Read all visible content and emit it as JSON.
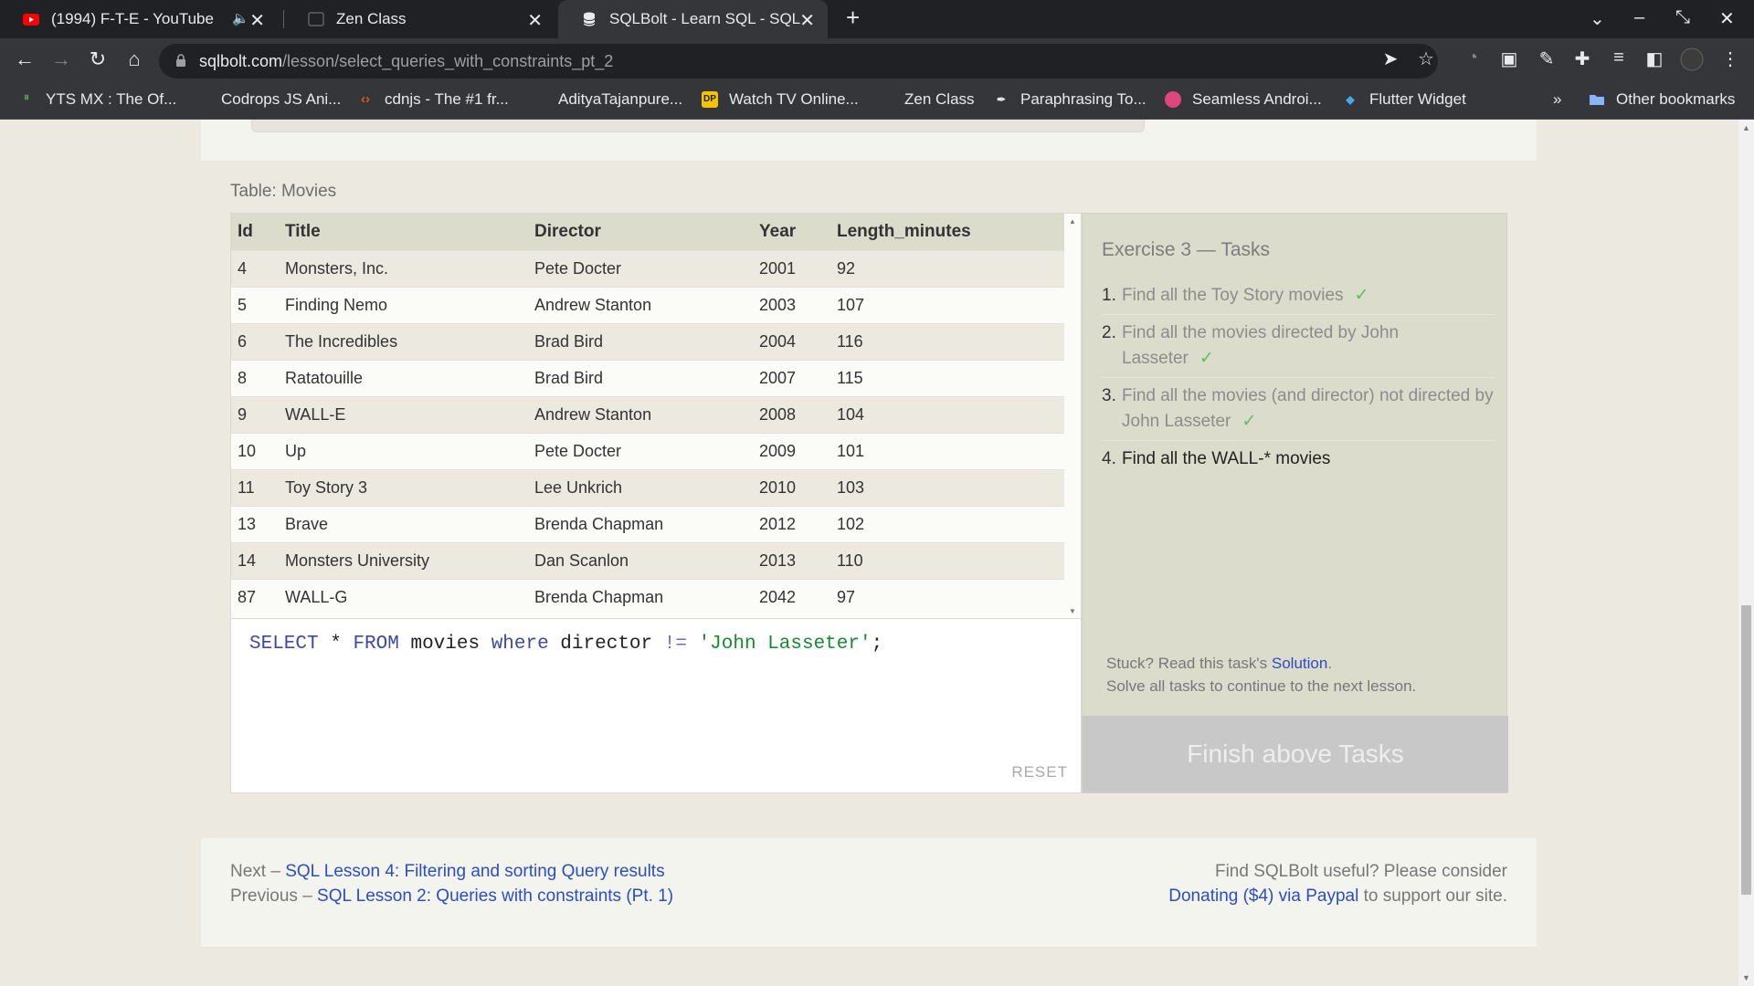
{
  "browser": {
    "tabs": [
      {
        "title": "(1994) F-T-E - YouTube",
        "icon": "youtube-icon",
        "muted_icon": "speaker-icon"
      },
      {
        "title": "Zen Class",
        "icon": "zen-class-icon"
      },
      {
        "title": "SQLBolt - Learn SQL - SQL L",
        "icon": "database-icon",
        "active": true
      }
    ],
    "new_tab": "+",
    "window_controls": {
      "dropdown": "⌄",
      "minimize": "–",
      "restore": "⤡",
      "close": "✕"
    },
    "url": {
      "host": "sqlbolt.com",
      "path": "/lesson/select_queries_with_constraints_pt_2"
    },
    "bookmarks": [
      {
        "label": "YTS MX : The Of...",
        "icon": "yts-icon",
        "color": "#6ac045"
      },
      {
        "label": "Codrops JS Ani...",
        "icon": "codrops-icon",
        "color": "#202124"
      },
      {
        "label": "cdnjs - The #1 fr...",
        "icon": "cdnjs-icon",
        "color": "#e95420"
      },
      {
        "label": "AdityaTajanpure...",
        "icon": "github-icon",
        "color": "#202124"
      },
      {
        "label": "Watch TV Online...",
        "icon": "dp-icon",
        "color": "#f6c300"
      },
      {
        "label": "Zen Class",
        "icon": "zen-class-icon",
        "color": "#202124"
      },
      {
        "label": "Paraphrasing To...",
        "icon": "quill-icon",
        "color": "#e8eaed"
      },
      {
        "label": "Seamless Androi...",
        "icon": "avatar-icon",
        "color": "#e0457b"
      },
      {
        "label": "Flutter Widget",
        "icon": "flutter-icon",
        "color": "#45a8ef"
      }
    ],
    "bookmarks_overflow": "»",
    "other_bookmarks": "Other bookmarks"
  },
  "lesson": {
    "table_caption": "Table: Movies",
    "columns": [
      "Id",
      "Title",
      "Director",
      "Year",
      "Length_minutes"
    ],
    "rows": [
      [
        "4",
        "Monsters, Inc.",
        "Pete Docter",
        "2001",
        "92"
      ],
      [
        "5",
        "Finding Nemo",
        "Andrew Stanton",
        "2003",
        "107"
      ],
      [
        "6",
        "The Incredibles",
        "Brad Bird",
        "2004",
        "116"
      ],
      [
        "8",
        "Ratatouille",
        "Brad Bird",
        "2007",
        "115"
      ],
      [
        "9",
        "WALL-E",
        "Andrew Stanton",
        "2008",
        "104"
      ],
      [
        "10",
        "Up",
        "Pete Docter",
        "2009",
        "101"
      ],
      [
        "11",
        "Toy Story 3",
        "Lee Unkrich",
        "2010",
        "103"
      ],
      [
        "13",
        "Brave",
        "Brenda Chapman",
        "2012",
        "102"
      ],
      [
        "14",
        "Monsters University",
        "Dan Scanlon",
        "2013",
        "110"
      ],
      [
        "87",
        "WALL-G",
        "Brenda Chapman",
        "2042",
        "97"
      ]
    ],
    "query": {
      "select": "SELECT",
      "star": " * ",
      "from": "FROM",
      "table": " movies ",
      "where": "where",
      "column": " director ",
      "op": "!=",
      "space": " ",
      "value": "'John Lasseter'",
      "end": ";"
    },
    "reset_label": "RESET",
    "tasks": {
      "title": "Exercise 3 — Tasks",
      "items": [
        {
          "num": "1.",
          "text": "Find all the Toy Story movies",
          "done": "✓"
        },
        {
          "num": "2.",
          "text": "Find all the movies directed by John Lasseter",
          "done": "✓"
        },
        {
          "num": "3.",
          "text": "Find all the movies (and director) not directed by John Lasseter",
          "done": "✓"
        },
        {
          "num": "4.",
          "text": "Find all the WALL-* movies",
          "done": ""
        }
      ],
      "stuck_prefix": "Stuck? Read this task's ",
      "solution_link": "Solution",
      "stuck_suffix": ".",
      "continue_note": "Solve all tasks to continue to the next lesson.",
      "finish_label": "Finish above Tasks"
    },
    "footer": {
      "next_prefix": "Next – ",
      "next_link": "SQL Lesson 4: Filtering and sorting Query results",
      "prev_prefix": "Previous – ",
      "prev_link": "SQL Lesson 2: Queries with constraints (Pt. 1)",
      "support_text": "Find SQLBolt useful? Please consider",
      "donate_link": "Donating ($4) via Paypal",
      "support_suffix": " to support our site."
    }
  },
  "colors": {
    "chrome_dark": "#202124",
    "chrome_toolbar": "#35363a",
    "link": "#2b4dc4",
    "keyword": "#3b49a7",
    "string": "#168a2e",
    "check": "#5cc05c",
    "tasks_bg": "#dcdccc"
  }
}
